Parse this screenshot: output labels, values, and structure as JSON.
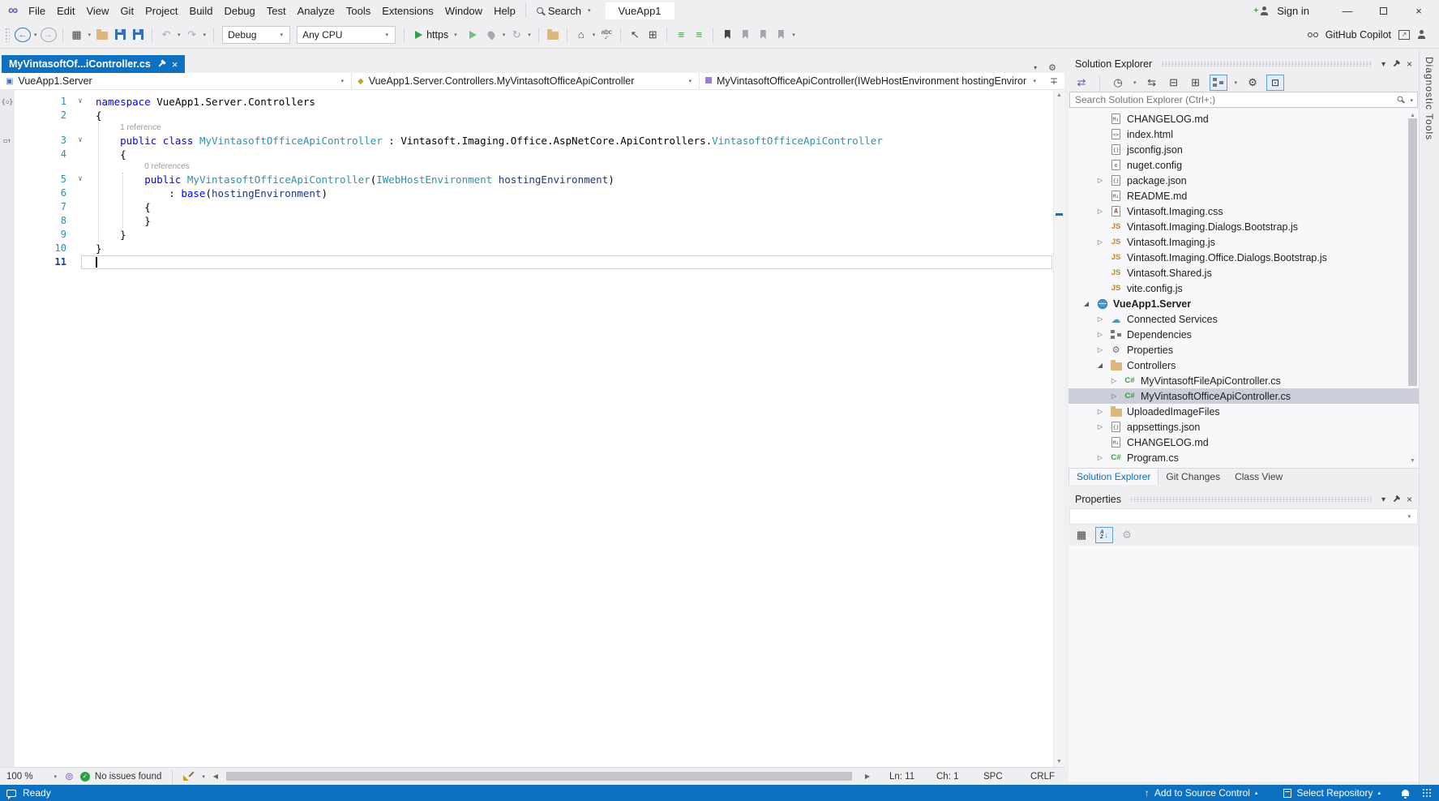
{
  "menu": {
    "items": [
      "File",
      "Edit",
      "View",
      "Git",
      "Project",
      "Build",
      "Debug",
      "Test",
      "Analyze",
      "Tools",
      "Extensions",
      "Window",
      "Help"
    ],
    "search_label": "Search",
    "solution_button": "VueApp1",
    "sign_in": "Sign in"
  },
  "toolbar": {
    "configuration": "Debug",
    "platform": "Any CPU",
    "run_profile": "https",
    "copilot_label": "GitHub Copilot"
  },
  "editor": {
    "tab_title": "MyVintasoftOf...iController.cs",
    "breadcrumbs": [
      "VueApp1.Server",
      "VueApp1.Server.Controllers.MyVintasoftOfficeApiController",
      "MyVintasoftOfficeApiController(IWebHostEnvironment hostingEnvironme"
    ],
    "code": {
      "rows": [
        {
          "kind": "code",
          "num": "1",
          "fold": true,
          "glyph": "code-outline",
          "tokens": [
            [
              "k",
              "namespace"
            ],
            [
              "d",
              " VueApp1.Server.Controllers"
            ]
          ]
        },
        {
          "kind": "code",
          "num": "2",
          "tokens": [
            [
              "d",
              "{"
            ]
          ]
        },
        {
          "kind": "lens",
          "cols": 4,
          "text": "1 reference"
        },
        {
          "kind": "code",
          "num": "3",
          "fold": true,
          "glyph": "inheritance",
          "tokens": [
            [
              "d",
              "    "
            ],
            [
              "k",
              "public"
            ],
            [
              "d",
              " "
            ],
            [
              "k",
              "class"
            ],
            [
              "d",
              " "
            ],
            [
              "ty",
              "MyVintasoftOfficeApiController"
            ],
            [
              "d",
              " : Vintasoft.Imaging.Office.AspNetCore.ApiControllers."
            ],
            [
              "ty",
              "VintasoftOfficeApiController"
            ]
          ]
        },
        {
          "kind": "code",
          "num": "4",
          "tokens": [
            [
              "d",
              "    {"
            ]
          ]
        },
        {
          "kind": "lens",
          "cols": 8,
          "text": "0 references"
        },
        {
          "kind": "code",
          "num": "5",
          "fold": true,
          "tokens": [
            [
              "d",
              "        "
            ],
            [
              "k",
              "public"
            ],
            [
              "d",
              " "
            ],
            [
              "ty",
              "MyVintasoftOfficeApiController"
            ],
            [
              "d",
              "("
            ],
            [
              "ty",
              "IWebHostEnvironment"
            ],
            [
              "d",
              " "
            ],
            [
              "pr",
              "hostingEnvironment"
            ],
            [
              "d",
              ")"
            ]
          ]
        },
        {
          "kind": "code",
          "num": "6",
          "tokens": [
            [
              "d",
              "            : "
            ],
            [
              "k",
              "base"
            ],
            [
              "d",
              "("
            ],
            [
              "pr",
              "hostingEnvironment"
            ],
            [
              "d",
              ")"
            ]
          ]
        },
        {
          "kind": "code",
          "num": "7",
          "tokens": [
            [
              "d",
              "        {"
            ]
          ]
        },
        {
          "kind": "code",
          "num": "8",
          "tokens": [
            [
              "d",
              "        }"
            ]
          ]
        },
        {
          "kind": "code",
          "num": "9",
          "tokens": [
            [
              "d",
              "    }"
            ]
          ]
        },
        {
          "kind": "code",
          "num": "10",
          "tokens": [
            [
              "d",
              "}"
            ]
          ]
        },
        {
          "kind": "code",
          "num": "11",
          "current": true,
          "tokens": []
        }
      ]
    },
    "status": {
      "zoom": "100 %",
      "issues": "No issues found",
      "line": "Ln: 11",
      "column": "Ch: 1",
      "mode": "SPC",
      "line_ending": "CRLF"
    }
  },
  "solution_explorer": {
    "title": "Solution Explorer",
    "search_placeholder": "Search Solution Explorer (Ctrl+;)",
    "tree": [
      {
        "lvl": 2,
        "icon": "md",
        "label": "CHANGELOG.md"
      },
      {
        "lvl": 2,
        "icon": "html",
        "label": "index.html"
      },
      {
        "lvl": 2,
        "icon": "json",
        "label": "jsconfig.json"
      },
      {
        "lvl": 2,
        "icon": "config",
        "label": "nuget.config"
      },
      {
        "lvl": 2,
        "exp": "c",
        "icon": "json",
        "label": "package.json"
      },
      {
        "lvl": 2,
        "icon": "md",
        "label": "README.md"
      },
      {
        "lvl": 2,
        "exp": "c",
        "icon": "css",
        "label": "Vintasoft.Imaging.css"
      },
      {
        "lvl": 2,
        "icon": "js",
        "label": "Vintasoft.Imaging.Dialogs.Bootstrap.js"
      },
      {
        "lvl": 2,
        "exp": "c",
        "icon": "js",
        "label": "Vintasoft.Imaging.js"
      },
      {
        "lvl": 2,
        "icon": "js",
        "label": "Vintasoft.Imaging.Office.Dialogs.Bootstrap.js"
      },
      {
        "lvl": 2,
        "icon": "js",
        "label": "Vintasoft.Shared.js"
      },
      {
        "lvl": 2,
        "icon": "js",
        "label": "vite.config.js"
      },
      {
        "lvl": 1,
        "exp": "e",
        "icon": "project",
        "label": "VueApp1.Server",
        "bold": true
      },
      {
        "lvl": 2,
        "exp": "c",
        "icon": "cloud",
        "label": "Connected Services"
      },
      {
        "lvl": 2,
        "exp": "c",
        "icon": "deps",
        "label": "Dependencies"
      },
      {
        "lvl": 2,
        "exp": "c",
        "icon": "props",
        "label": "Properties"
      },
      {
        "lvl": 2,
        "exp": "e",
        "icon": "folder",
        "label": "Controllers"
      },
      {
        "lvl": 3,
        "exp": "c",
        "icon": "cs",
        "label": "MyVintasoftFileApiController.cs"
      },
      {
        "lvl": 3,
        "exp": "c",
        "icon": "cs",
        "label": "MyVintasoftOfficeApiController.cs",
        "selected": true
      },
      {
        "lvl": 2,
        "exp": "c",
        "icon": "folder",
        "label": "UploadedImageFiles"
      },
      {
        "lvl": 2,
        "exp": "c",
        "icon": "json",
        "label": "appsettings.json"
      },
      {
        "lvl": 2,
        "icon": "md",
        "label": "CHANGELOG.md"
      },
      {
        "lvl": 2,
        "exp": "c",
        "icon": "cs",
        "label": "Program.cs"
      }
    ],
    "tabs": [
      "Solution Explorer",
      "Git Changes",
      "Class View"
    ]
  },
  "properties_panel": {
    "title": "Properties"
  },
  "status_bar": {
    "ready": "Ready",
    "add_to_source_control": "Add to Source Control",
    "select_repository": "Select Repository"
  },
  "right_strip_label": "Diagnostic Tools",
  "colors": {
    "accent_blue": "#0E70C0",
    "chrome": "#EFEFF2",
    "tree_selection": "#CCCEDB",
    "keyword": "#0000FF",
    "type_name": "#2B91AF",
    "parameter": "#1F377F",
    "line_number": "#2B91AF",
    "run_green": "#2F9E44",
    "folder": "#DCB67A",
    "js_badge": "#B5872F",
    "csharp_badge": "#2E9E3E"
  },
  "icons": {
    "search": "magnifier",
    "settings": "gear",
    "run": "green-play",
    "bookmark": "ribbon",
    "notifications": "bell",
    "feedback": "speech-bubble"
  }
}
